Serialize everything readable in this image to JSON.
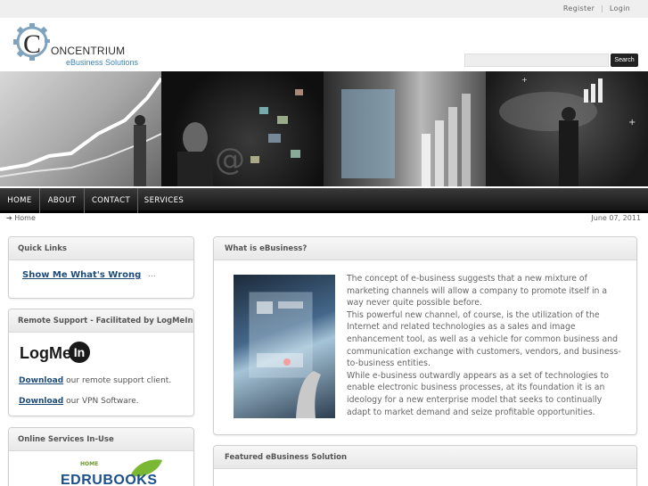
{
  "topbar": {
    "register": "Register",
    "separator": "|",
    "login": "Login"
  },
  "header": {
    "logo_text_prefix": "C",
    "logo_text": "ONCENTRIUM",
    "logo_sub": "eBusiness Solutions",
    "search_placeholder": "",
    "search_button": "Search"
  },
  "nav": [
    {
      "label": "HOME"
    },
    {
      "label": "ABOUT"
    },
    {
      "label": "CONTACT"
    },
    {
      "label": "SERVICES"
    }
  ],
  "breadcrumb": {
    "arrow": "➔",
    "label": "Home"
  },
  "date": "June 07, 2011",
  "quick_links": {
    "title": "Quick Links",
    "link": "Show Me What's Wrong",
    "more": "..."
  },
  "remote_support": {
    "title": "Remote Support - Facilitated by LogMeIn",
    "logo_text": "LogMe",
    "logo_in": "In",
    "row1_link": "Download",
    "row1_text": "our remote support client.",
    "row2_link": "Download",
    "row2_text": "our VPN Software."
  },
  "online_services": {
    "title": "Online Services In-Use",
    "logo_top": "HOME",
    "logo_text": "EDRUBOOKS"
  },
  "what_is": {
    "title": "What is eBusiness?",
    "paragraphs": [
      "The concept of e-business suggests that a new mixture of marketing channels will allow a company to promote itself in a way never quite possible before.",
      "This powerful new channel, of course, is the utilization of the Internet and related technologies as a sales and image enhancement tool, as well as a vehicle for common business and communication exchange with customers, vendors, and business-to-business entities.",
      "While e-business outwardly appears as a set of technologies to enable electronic business processes, at its foundation it is an ideology for a new enterprise model that seeks to continually adapt to market demand and seize profitable opportunities."
    ]
  },
  "featured": {
    "title": "Featured eBusiness Solution"
  },
  "colors": {
    "link": "#1e4c7a",
    "logo_sub": "#3d84b8",
    "nav_bg": "#1f1f1f"
  },
  "icons": [
    "gear-icon",
    "arrow-right-icon",
    "search-icon"
  ]
}
